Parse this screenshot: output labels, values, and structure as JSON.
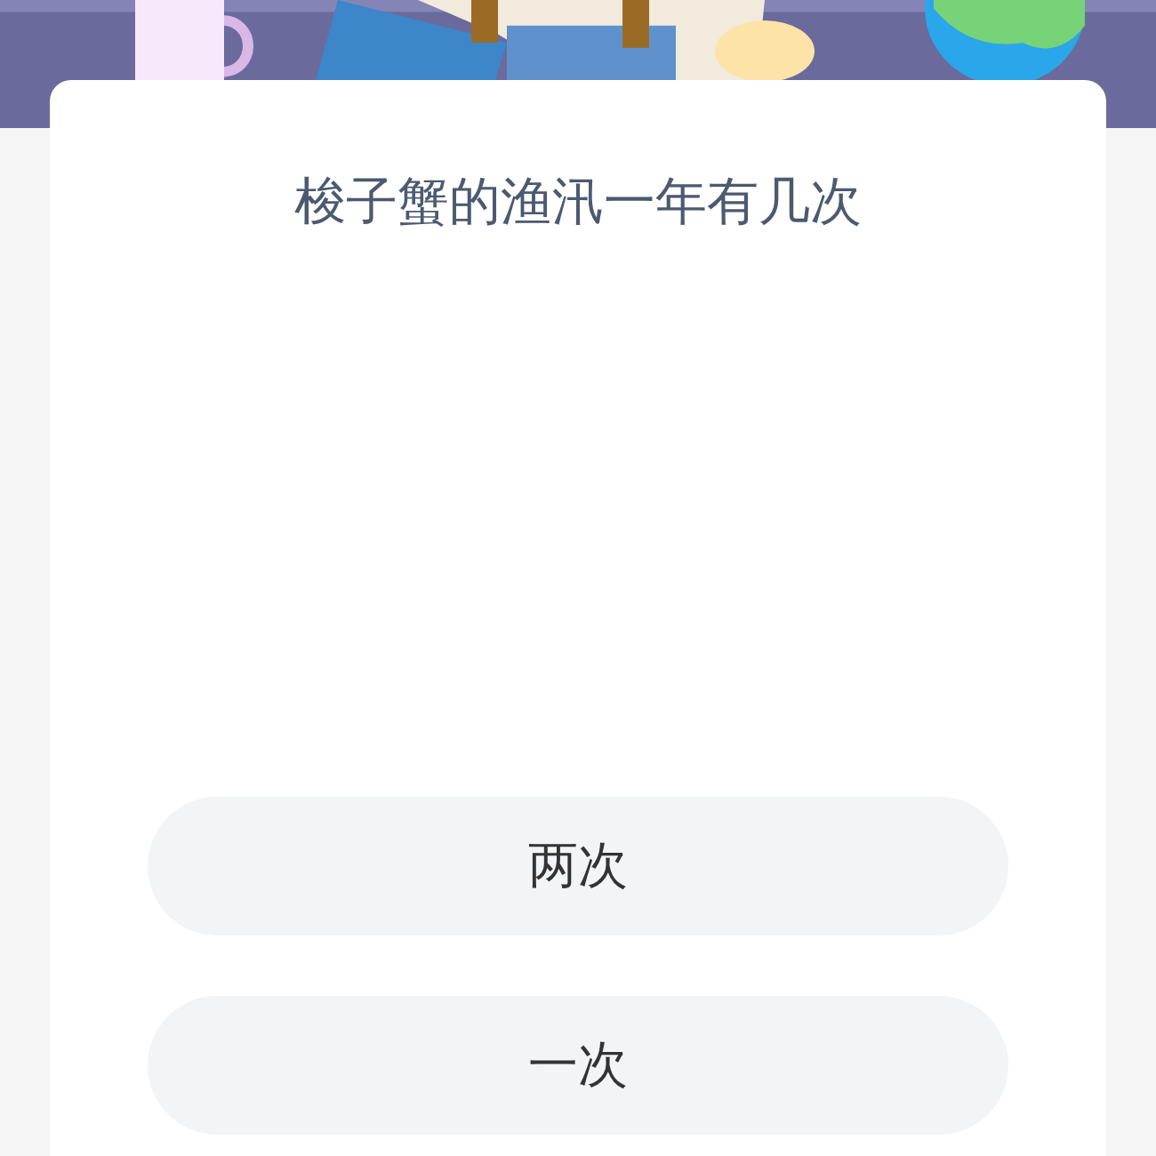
{
  "question": "梭子蟹的渔汛一年有几次",
  "options": [
    {
      "label": "两次"
    },
    {
      "label": "一次"
    }
  ]
}
